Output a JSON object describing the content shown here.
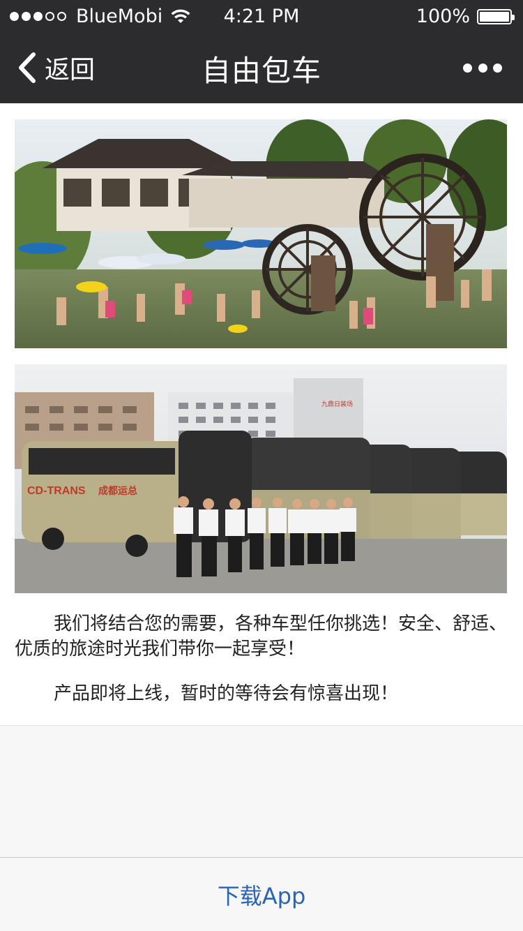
{
  "status_bar": {
    "carrier": "BlueMobi",
    "time": "4:21 PM",
    "battery": "100%",
    "signal_bars_filled": 3,
    "signal_bars_total": 5
  },
  "nav": {
    "back_label": "返回",
    "title": "自由包车"
  },
  "content": {
    "paragraph1": "我们将结合您的需要，各种车型任你挑选！安全、舒适、优质的旅途时光我们带你一起享受！",
    "paragraph2": "产品即将上线，暂时的等待会有惊喜出现！",
    "bus_text": "CD-TRANS",
    "bus_text_cn": "成都运总",
    "building_sign": "九鼎日装场"
  },
  "footer": {
    "download_label": "下载App"
  },
  "colors": {
    "bar_bg": "#2c2c2e",
    "link_blue": "#2a63b8",
    "page_bg": "#f7f7f7"
  },
  "icons": {
    "back": "chevron-left-icon",
    "more": "more-dots-icon",
    "wifi": "wifi-icon",
    "battery": "battery-icon"
  }
}
